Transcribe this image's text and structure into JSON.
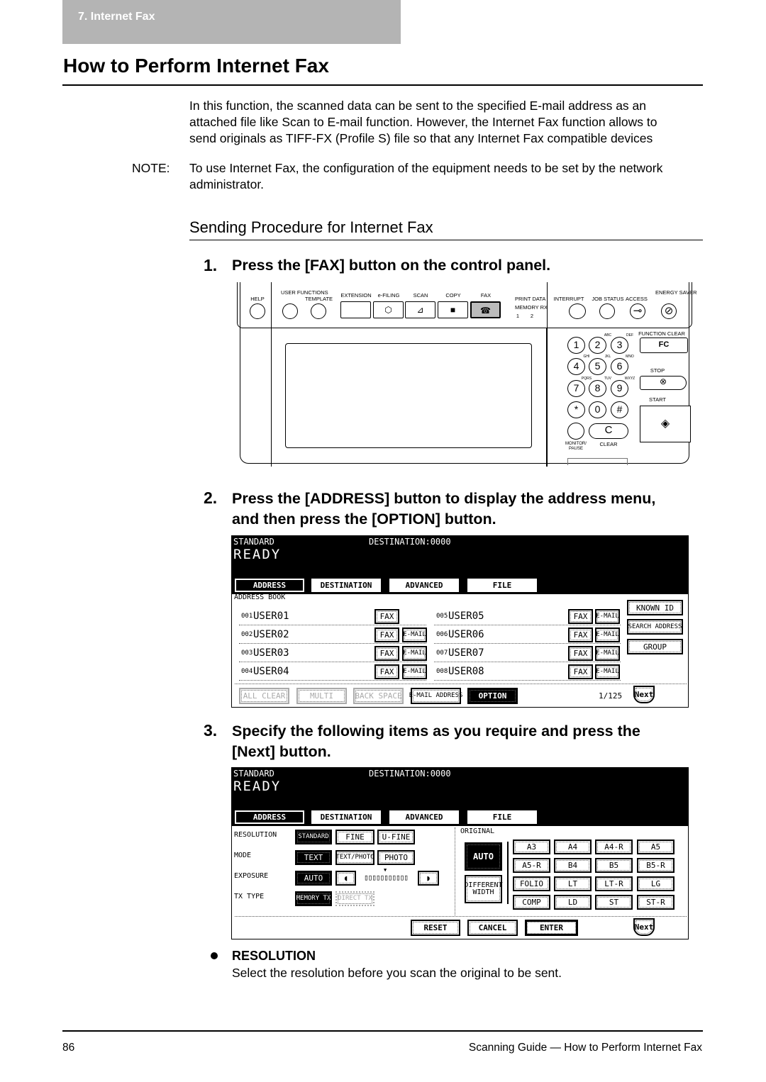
{
  "header": {
    "chapter": "7. Internet Fax"
  },
  "title": "How to Perform Internet Fax",
  "intro": [
    "In this function, the scanned data can be sent to the specified E-mail address as an",
    "attached file like Scan to E-mail function.  However, the Internet Fax function allows to",
    "send originals as TIFF-FX (Profile S) file so that any Internet Fax compatible devices"
  ],
  "note": {
    "label": "NOTE:",
    "lines": [
      "To use Internet Fax, the configuration of the equipment needs to be set by the network",
      "administrator."
    ]
  },
  "section_title": "Sending Procedure for Internet Fax",
  "steps": [
    {
      "number": "1.",
      "lines": [
        "Press the [FAX] button on the control panel."
      ]
    },
    {
      "number": "2.",
      "lines": [
        "Press the [ADDRESS] button to display the address menu,",
        "and then press the [OPTION] button."
      ]
    },
    {
      "number": "3.",
      "lines": [
        "Specify the following items as you require and press the",
        "[Next] button."
      ]
    }
  ],
  "control_panel": {
    "labels": {
      "help": "HELP",
      "user_functions": "USER FUNCTIONS",
      "template": "TEMPLATE",
      "extension": "EXTENSION",
      "efiling": "e-FILING",
      "scan": "SCAN",
      "copy": "COPY",
      "fax": "FAX",
      "print_data": "PRINT DATA",
      "memory_rx": "MEMORY RX",
      "line1": "1",
      "line2": "2",
      "interrupt": "INTERRUPT",
      "job_status": "JOB STATUS",
      "access": "ACCESS",
      "energy_saver": "ENERGY SAVER",
      "function_clear": "FUNCTION CLEAR",
      "fc": "FC",
      "stop": "STOP",
      "start": "START",
      "monitor_pause": "MONITOR/ PAUSE",
      "clear": "CLEAR",
      "clear_key": "C"
    },
    "keypad": [
      "1",
      "2",
      "3",
      "4",
      "5",
      "6",
      "7",
      "8",
      "9",
      "*",
      "0",
      "#"
    ],
    "keypad_letters": [
      "",
      "ABC",
      "DEF",
      "GHI",
      "JKL",
      "MNO",
      "PQRS",
      "TUV",
      "WXYZ",
      "",
      "",
      ""
    ],
    "active_button": "FAX"
  },
  "screen1": {
    "mode": "STANDARD",
    "destination": "DESTINATION:0000",
    "status": "READY",
    "tabs": [
      "ADDRESS",
      "DESTINATION",
      "ADVANCED",
      "FILE"
    ],
    "active_tab": "ADDRESS",
    "section_label": "ADDRESS BOOK",
    "entries": [
      {
        "num": "001",
        "name": "USER01",
        "fax": "FAX",
        "email": ""
      },
      {
        "num": "002",
        "name": "USER02",
        "fax": "FAX",
        "email": "E-MAIL"
      },
      {
        "num": "003",
        "name": "USER03",
        "fax": "FAX",
        "email": "E-MAIL"
      },
      {
        "num": "004",
        "name": "USER04",
        "fax": "FAX",
        "email": "E-MAIL"
      },
      {
        "num": "005",
        "name": "USER05",
        "fax": "FAX",
        "email": "E-MAIL"
      },
      {
        "num": "006",
        "name": "USER06",
        "fax": "FAX",
        "email": "E-MAIL"
      },
      {
        "num": "007",
        "name": "USER07",
        "fax": "FAX",
        "email": "E-MAIL"
      },
      {
        "num": "008",
        "name": "USER08",
        "fax": "FAX",
        "email": "E-MAIL"
      }
    ],
    "side_buttons": [
      "KNOWN ID",
      "SEARCH ADDRESS",
      "GROUP"
    ],
    "bottom_buttons": [
      "ALL CLEAR",
      "MULTI",
      "BACK SPACE",
      "E-MAIL ADDRESS",
      "OPTION"
    ],
    "page": "1/125",
    "next": "Next"
  },
  "screen2": {
    "mode": "STANDARD",
    "destination": "DESTINATION:0000",
    "status": "READY",
    "tabs": [
      "ADDRESS",
      "DESTINATION",
      "ADVANCED",
      "FILE"
    ],
    "active_tab": "ADDRESS",
    "rows": [
      {
        "label": "RESOLUTION",
        "options": [
          "STANDARD",
          "FINE",
          "U-FINE"
        ],
        "selected": "STANDARD"
      },
      {
        "label": "MODE",
        "options": [
          "TEXT",
          "TEXT/PHOTO",
          "PHOTO"
        ],
        "selected": "TEXT"
      },
      {
        "label": "EXPOSURE",
        "options": [
          "AUTO"
        ],
        "selected": "AUTO",
        "level": "5 of 11"
      },
      {
        "label": "TX TYPE",
        "options": [
          "MEMORY TX",
          "DIRECT TX"
        ],
        "selected": "MEMORY TX"
      }
    ],
    "original_label": "ORIGINAL",
    "original_auto": "AUTO",
    "different_width": "DIFFERENT WIDTH",
    "sizes": [
      "A3",
      "A4",
      "A4-R",
      "A5",
      "A5-R",
      "B4",
      "B5",
      "B5-R",
      "FOLIO",
      "LT",
      "LT-R",
      "LG",
      "COMP",
      "LD",
      "ST",
      "ST-R"
    ],
    "bottom_buttons": [
      "RESET",
      "CANCEL",
      "ENTER"
    ],
    "next": "Next"
  },
  "bullet": {
    "title": "RESOLUTION",
    "text": "Select the resolution before you scan the original to be sent."
  },
  "footer": {
    "page_number": "86",
    "text": "Scanning Guide — How to Perform Internet Fax"
  }
}
